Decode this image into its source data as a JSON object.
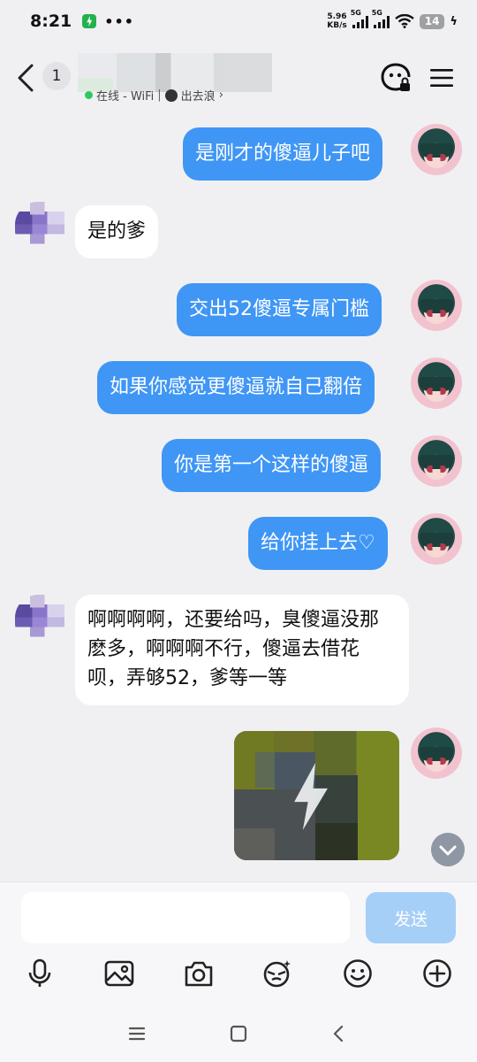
{
  "status_bar": {
    "time": "8:21",
    "more": "•••",
    "net_speed_value": "5.96",
    "net_speed_unit": "KB/s",
    "signal1_label": "5G",
    "signal2_label": "5G",
    "battery": "14",
    "charging": "ϟ"
  },
  "header": {
    "unread_count": "1",
    "presence_status": "在线 - WiFi",
    "presence_separator": "|",
    "activity": "出去浪",
    "activity_chevron": "›"
  },
  "messages": [
    {
      "from": "me",
      "text": "是刚才的傻逼儿子吧"
    },
    {
      "from": "other",
      "text": "是的爹"
    },
    {
      "from": "me",
      "text": "交出52傻逼专属门槛"
    },
    {
      "from": "me",
      "text": "如果你感觉更傻逼就自己翻倍"
    },
    {
      "from": "me",
      "text": "你是第一个这样的傻逼"
    },
    {
      "from": "me",
      "text": "给你挂上去♡"
    },
    {
      "from": "other",
      "text": "啊啊啊啊，还要给吗，臭傻逼没那麽多，啊啊啊不行，傻逼去借花呗，弄够52，爹等一等"
    },
    {
      "from": "me",
      "type": "image"
    }
  ],
  "composer": {
    "input_value": "",
    "send_label": "发送"
  },
  "colors": {
    "my_bubble": "#3f96f5",
    "other_bubble": "#ffffff",
    "background": "#f0f0f3",
    "send_button": "#a6cff8"
  },
  "icons": {
    "toolbar": [
      "microphone-icon",
      "image-icon",
      "camera-icon",
      "sticker-face-icon",
      "emoji-icon",
      "plus-icon"
    ],
    "nav": [
      "menu-lines-icon",
      "home-square-icon",
      "back-arrow-icon"
    ]
  }
}
